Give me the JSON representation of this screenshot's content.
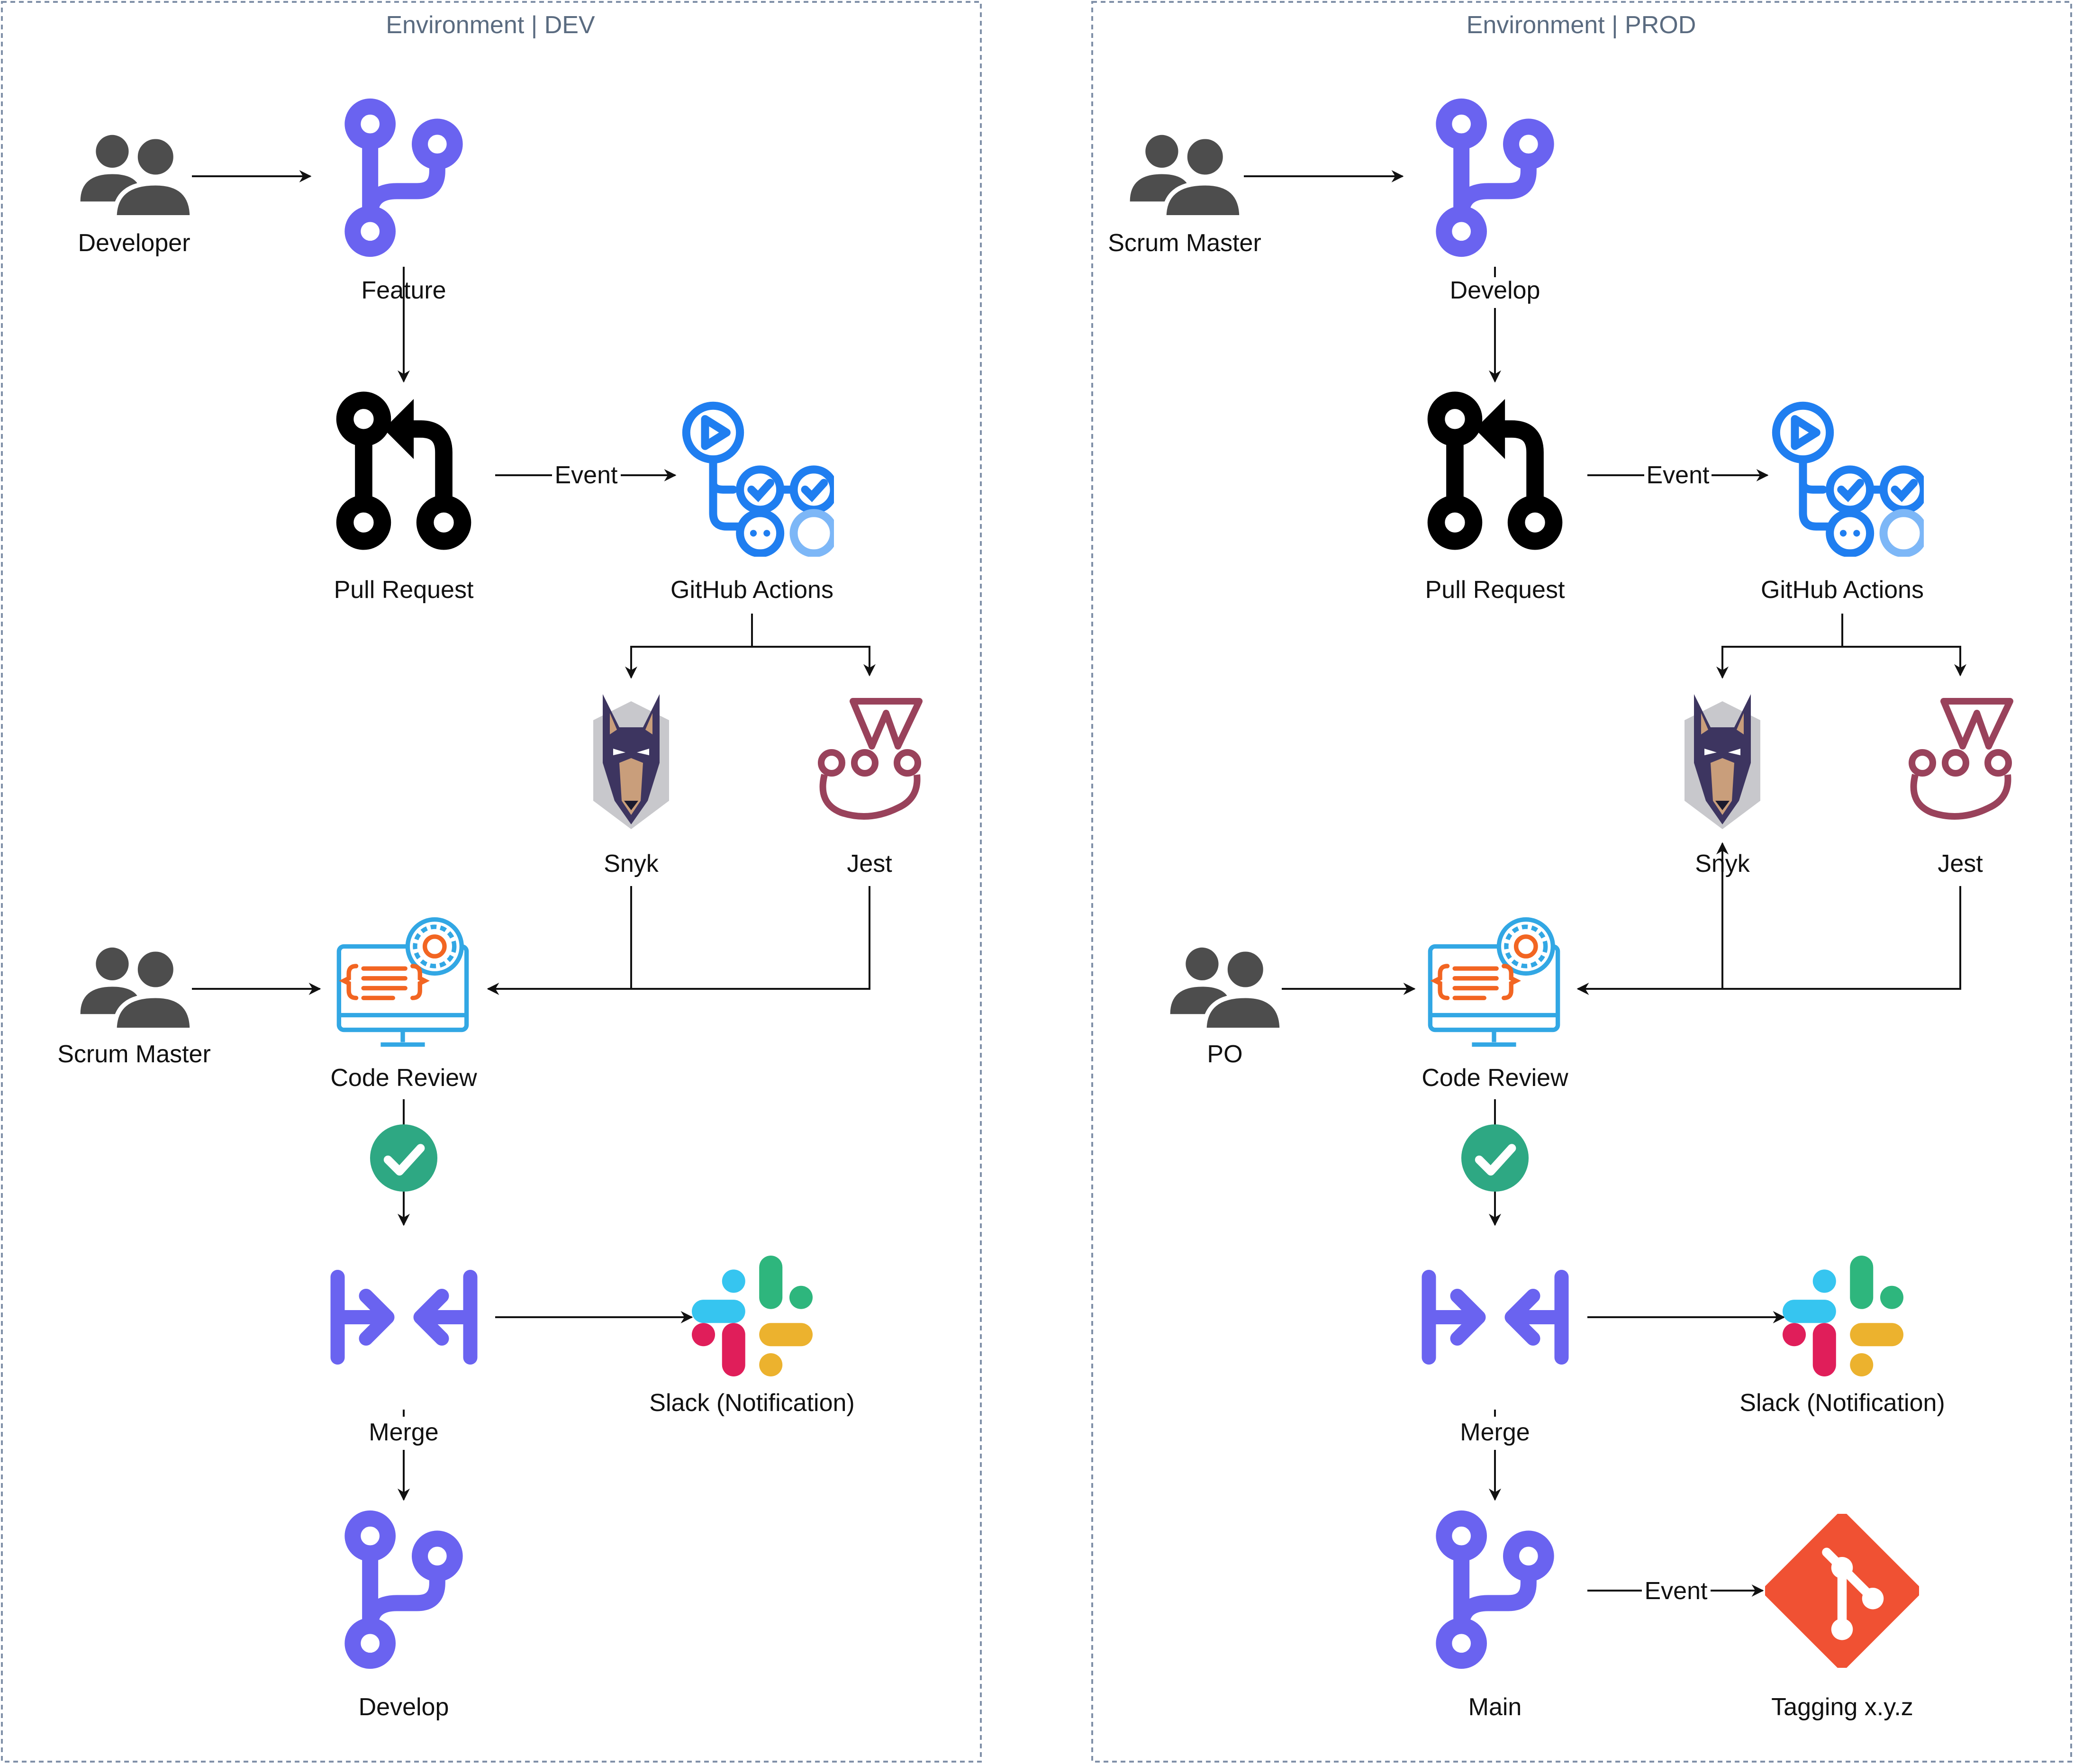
{
  "colors": {
    "branch": "#6a63f0",
    "merge": "#6a63f0",
    "actions": "#1f7ef0",
    "actions_light": "#7db7f7",
    "jest": "#99425b",
    "check": "#2ea883",
    "git": "#f05133",
    "people": "#4d4d4d",
    "review_blue": "#32a7e4",
    "review_orange": "#f26522",
    "env_border": "#8090a8",
    "edge": "#111111",
    "slack_blue": "#36c5f0",
    "slack_green": "#2eb67d",
    "slack_yellow": "#ecb22e",
    "slack_red": "#e01e5a"
  },
  "environments": {
    "dev": {
      "title": "Environment | DEV",
      "developer": "Developer",
      "feature": "Feature",
      "pull_request": "Pull Request",
      "event": "Event",
      "github_actions": "GitHub Actions",
      "snyk": "Snyk",
      "jest": "Jest",
      "reviewer": "Scrum Master",
      "code_review": "Code Review",
      "merge": "Merge",
      "slack": "Slack (Notification)",
      "target_branch": "Develop"
    },
    "prod": {
      "title": "Environment | PROD",
      "author": "Scrum Master",
      "source_branch": "Develop",
      "pull_request": "Pull Request",
      "event": "Event",
      "github_actions": "GitHub Actions",
      "snyk": "Snyk",
      "jest": "Jest",
      "reviewer": "PO",
      "code_review": "Code Review",
      "merge": "Merge",
      "slack": "Slack (Notification)",
      "target_branch": "Main",
      "tag_event": "Event",
      "tagging": "Tagging x.y.z"
    }
  }
}
